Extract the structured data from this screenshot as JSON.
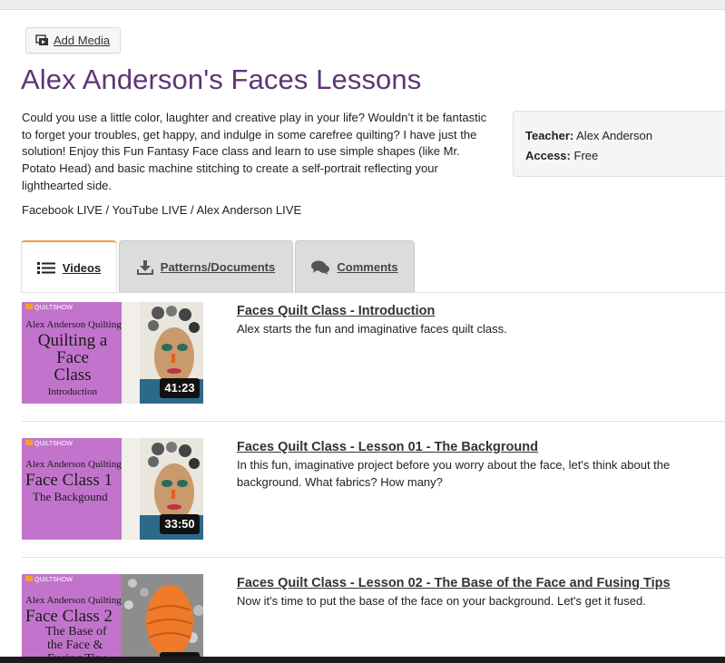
{
  "toolbar": {
    "add_media_label": "Add Media"
  },
  "page": {
    "title": "Alex Anderson's Faces Lessons",
    "description": "Could you use a little color, laughter and creative play in your life? Wouldn’t it be fantastic to forget your troubles, get happy, and indulge in some carefree quilting?  I have just the solution!  Enjoy this Fun Fantasy Face class and learn to use simple shapes (like Mr. Potato Head) and basic machine stitching to create a self-portrait reflecting your lighthearted side.",
    "channels": "Facebook LIVE / YouTube LIVE / Alex Anderson LIVE"
  },
  "info": {
    "teacher_label": "Teacher:",
    "teacher_value": "Alex Anderson",
    "access_label": "Access:",
    "access_value": "Free"
  },
  "tabs": [
    {
      "label": "Videos",
      "icon": "list-icon",
      "active": true
    },
    {
      "label": "Patterns/Documents",
      "icon": "download-icon",
      "active": false
    },
    {
      "label": "Comments",
      "icon": "comments-icon",
      "active": false
    }
  ],
  "colors": {
    "title": "#5e3577",
    "thumb_pink": "#c274cc",
    "active_tab_accent": "#f0a040"
  },
  "videos": [
    {
      "title": "Faces Quilt Class - Introduction",
      "description": "Alex starts the fun and imaginative faces quilt class.",
      "duration": "41:23",
      "thumb": {
        "logo": "QUILTSHOW",
        "brand": "Alex Anderson Quilting",
        "lines": [
          "Quilting a",
          "Face",
          "Class",
          "Introduction"
        ]
      }
    },
    {
      "title": "Faces Quilt Class - Lesson 01 - The Background",
      "description": "In this fun, imaginative project before you worry about the face, let's think about the background. What fabrics? How many?",
      "duration": "33:50",
      "thumb": {
        "logo": "QUILTSHOW",
        "brand": "Alex Anderson Quilting",
        "lines": [
          "Face Class 1",
          "The Backgound"
        ]
      }
    },
    {
      "title": "Faces Quilt Class - Lesson 02 - The Base of the Face and Fusing Tips",
      "description": "Now it's time to put the base of the face on your background. Let's get it fused.",
      "duration": "",
      "thumb": {
        "logo": "QUILTSHOW",
        "brand": "Alex Anderson Quilting",
        "lines": [
          "Face Class 2",
          "The Base of",
          "the Face &",
          "Fusing Tips"
        ]
      }
    }
  ]
}
